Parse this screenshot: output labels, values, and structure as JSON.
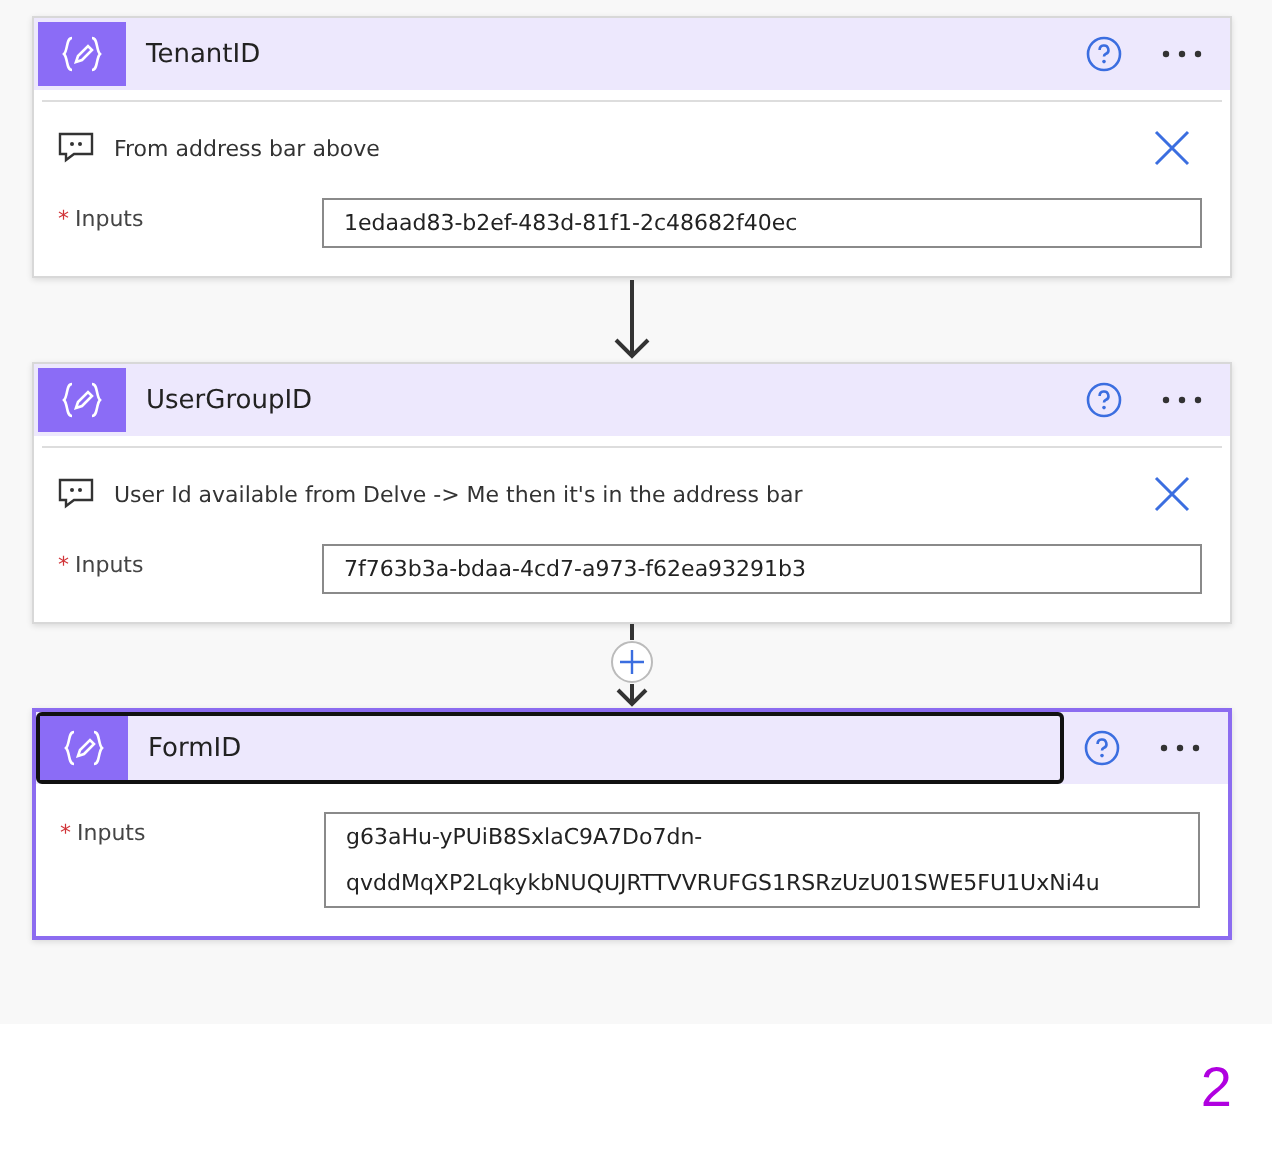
{
  "cards": [
    {
      "title": "TenantID",
      "selected": false,
      "comment": "From address bar above",
      "input_label": "Inputs",
      "required_mark": "*",
      "value": "1edaad83-b2ef-483d-81f1-2c48682f40ec"
    },
    {
      "title": "UserGroupID",
      "selected": false,
      "comment": "User Id available from Delve -> Me then it's in the address bar",
      "input_label": "Inputs",
      "required_mark": "*",
      "value": "7f763b3a-bdaa-4cd7-a973-f62ea93291b3"
    },
    {
      "title": "FormID",
      "selected": true,
      "input_label": "Inputs",
      "required_mark": "*",
      "value": "g63aHu-yPUiB8SxlaC9A7Do7dn-qvddMqXP2LqkykbNUQUJRTTVVRUFGS1RSRzUzU01SWE5FU1UxNi4u"
    }
  ],
  "connectors": [
    {
      "kind": "arrow"
    },
    {
      "kind": "plus"
    }
  ],
  "page_number": "2"
}
